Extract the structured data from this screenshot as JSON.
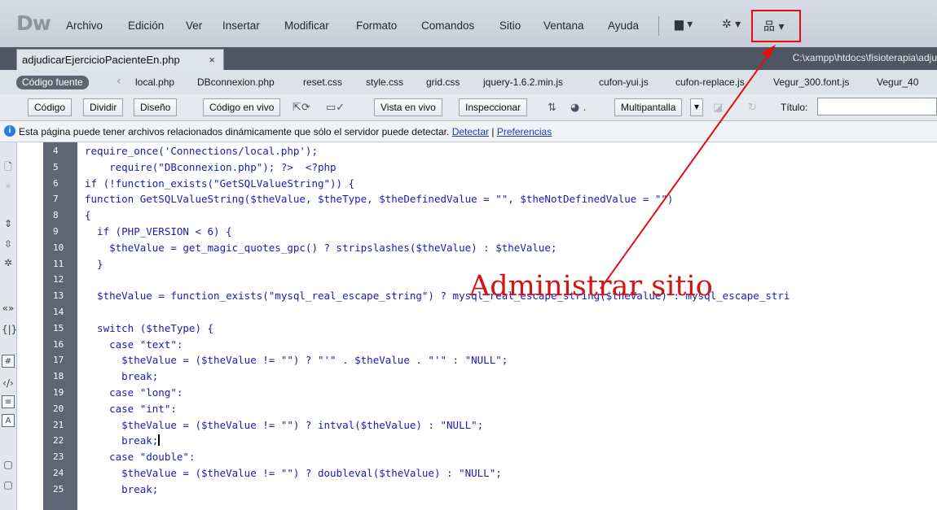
{
  "app": {
    "logo": "Dw"
  },
  "menu": [
    "Archivo",
    "Edición",
    "Ver",
    "Insertar",
    "Modificar",
    "Formato",
    "Comandos",
    "Sitio",
    "Ventana",
    "Ayuda"
  ],
  "toolbar_icons": [
    {
      "name": "layout-icon",
      "glyph": "▆ ▾"
    },
    {
      "name": "gear-icon",
      "glyph": "✲ ▾"
    },
    {
      "name": "site-manager-icon",
      "glyph": "品 ▾"
    }
  ],
  "document": {
    "tab_label": "adjudicarEjercicioPacienteEn.php",
    "close_glyph": "×",
    "path": "C:\\xampp\\htdocs\\fisioterapia\\adju"
  },
  "related_files": {
    "source_label": "Código fuente",
    "files": [
      "local.php",
      "DBconnexion.php",
      "reset.css",
      "style.css",
      "grid.css",
      "jquery-1.6.2.min.js",
      "cufon-yui.js",
      "cufon-replace.js",
      "Vegur_300.font.js",
      "Vegur_40"
    ]
  },
  "view_bar": {
    "code": "Código",
    "split": "Dividir",
    "design": "Diseño",
    "live_code": "Código en vivo",
    "live_view": "Vista en vivo",
    "inspect": "Inspeccionar",
    "multiscreen": "Multipantalla",
    "title_label": "Título:",
    "title_value": ""
  },
  "info_bar": {
    "message": "Esta página puede tener archivos relacionados dinámicamente que sólo el servidor puede detectar.",
    "detect": "Detectar",
    "separator": "|",
    "prefs": "Preferencias"
  },
  "code": {
    "lines": [
      {
        "n": "4",
        "text": "require_once('Connections/local.php');"
      },
      {
        "n": "5",
        "text": "    require(\"DBconnexion.php\"); ?>  <?php"
      },
      {
        "n": "6",
        "text": "if (!function_exists(\"GetSQLValueString\")) {"
      },
      {
        "n": "7",
        "text": "function GetSQLValueString($theValue, $theType, $theDefinedValue = \"\", $theNotDefinedValue = \"\")"
      },
      {
        "n": "8",
        "text": "{"
      },
      {
        "n": "9",
        "text": "  if (PHP_VERSION < 6) {"
      },
      {
        "n": "10",
        "text": "    $theValue = get_magic_quotes_gpc() ? stripslashes($theValue) : $theValue;"
      },
      {
        "n": "11",
        "text": "  }"
      },
      {
        "n": "12",
        "text": ""
      },
      {
        "n": "13",
        "text": "  $theValue = function_exists(\"mysql_real_escape_string\") ? mysql_real_escape_string($theValue) : mysql_escape_stri"
      },
      {
        "n": "14",
        "text": ""
      },
      {
        "n": "15",
        "text": "  switch ($theType) {"
      },
      {
        "n": "16",
        "text": "    case \"text\":"
      },
      {
        "n": "17",
        "text": "      $theValue = ($theValue != \"\") ? \"'\" . $theValue . \"'\" : \"NULL\";"
      },
      {
        "n": "18",
        "text": "      break;"
      },
      {
        "n": "19",
        "text": "    case \"long\":"
      },
      {
        "n": "20",
        "text": "    case \"int\":"
      },
      {
        "n": "21",
        "text": "      $theValue = ($theValue != \"\") ? intval($theValue) : \"NULL\";"
      },
      {
        "n": "22",
        "text": "      break;"
      },
      {
        "n": "23",
        "text": "    case \"double\":"
      },
      {
        "n": "24",
        "text": "      $theValue = ($theValue != \"\") ? doubleval($theValue) : \"NULL\";"
      },
      {
        "n": "25",
        "text": "      break;"
      }
    ]
  },
  "annotation": {
    "label": "Administrar sitio",
    "color": "#d41313"
  },
  "colors": {
    "menubar": "#cfd5de",
    "tabbar": "#4e5663",
    "gutter": "#5d6674",
    "code": "#1a1ab4",
    "code_string": "#b8141c"
  }
}
